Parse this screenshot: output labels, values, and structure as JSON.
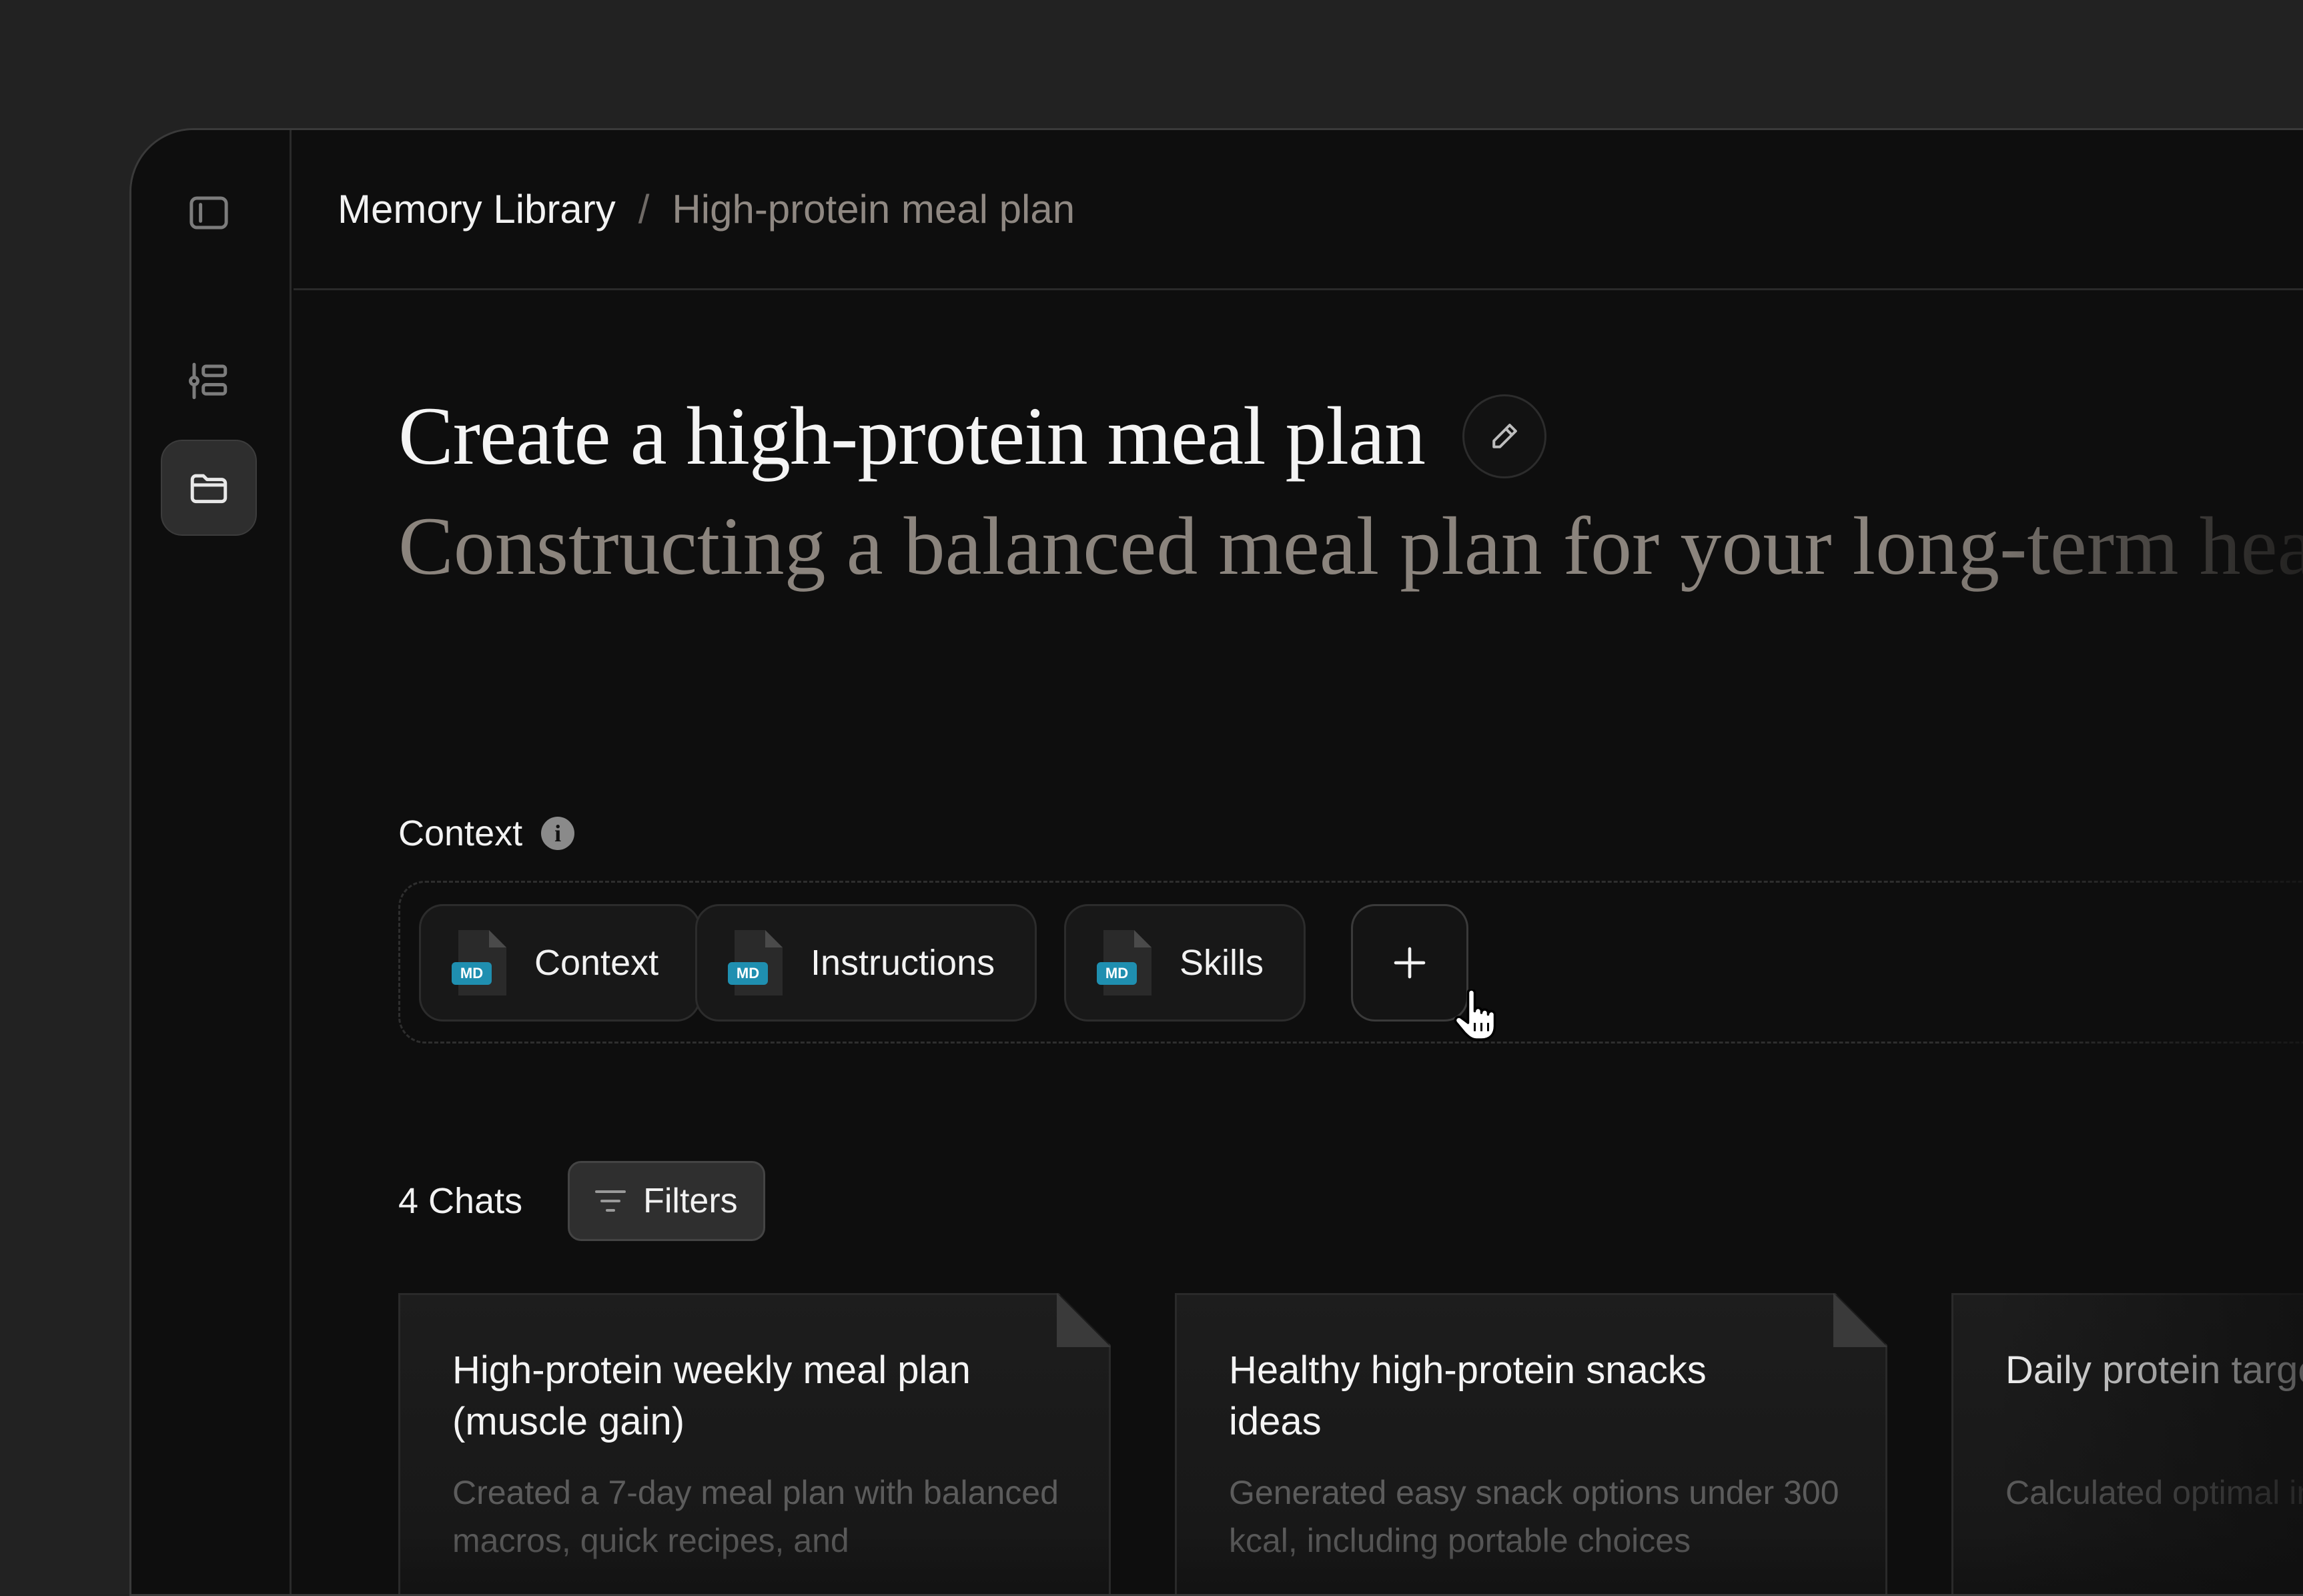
{
  "sidebar": {
    "items": [
      {
        "icon": "sidebar-toggle-icon"
      },
      {
        "icon": "tasks-list-icon"
      },
      {
        "icon": "folder-icon",
        "active": true
      }
    ]
  },
  "breadcrumb": {
    "root": "Memory Library",
    "separator": "/",
    "current": "High-protein meal plan"
  },
  "page": {
    "title": "Create a high-protein meal plan",
    "subtitle": "Constructing a balanced meal plan for your long-term health"
  },
  "context": {
    "label": "Context",
    "info_icon": "info-icon",
    "files": [
      {
        "label": "Context",
        "badge": "MD"
      },
      {
        "label": "Instructions",
        "badge": "MD"
      },
      {
        "label": "Skills",
        "badge": "MD"
      }
    ],
    "add_icon": "plus-icon"
  },
  "chats": {
    "count_label": "4 Chats",
    "filters_label": "Filters",
    "cards": [
      {
        "title": "High-protein weekly meal plan (muscle gain)",
        "desc": "Created a 7-day meal plan with balanced macros, quick recipes, and"
      },
      {
        "title": "Healthy high-protein snacks ideas",
        "desc": "Generated easy snack options under 300 kcal, including portable choices"
      },
      {
        "title": "Daily protein target calculator",
        "desc": "Calculated optimal intake based on"
      }
    ]
  },
  "colors": {
    "background": "#222222",
    "window": "#0e0e0e",
    "md_badge": "#1f8fb0"
  }
}
